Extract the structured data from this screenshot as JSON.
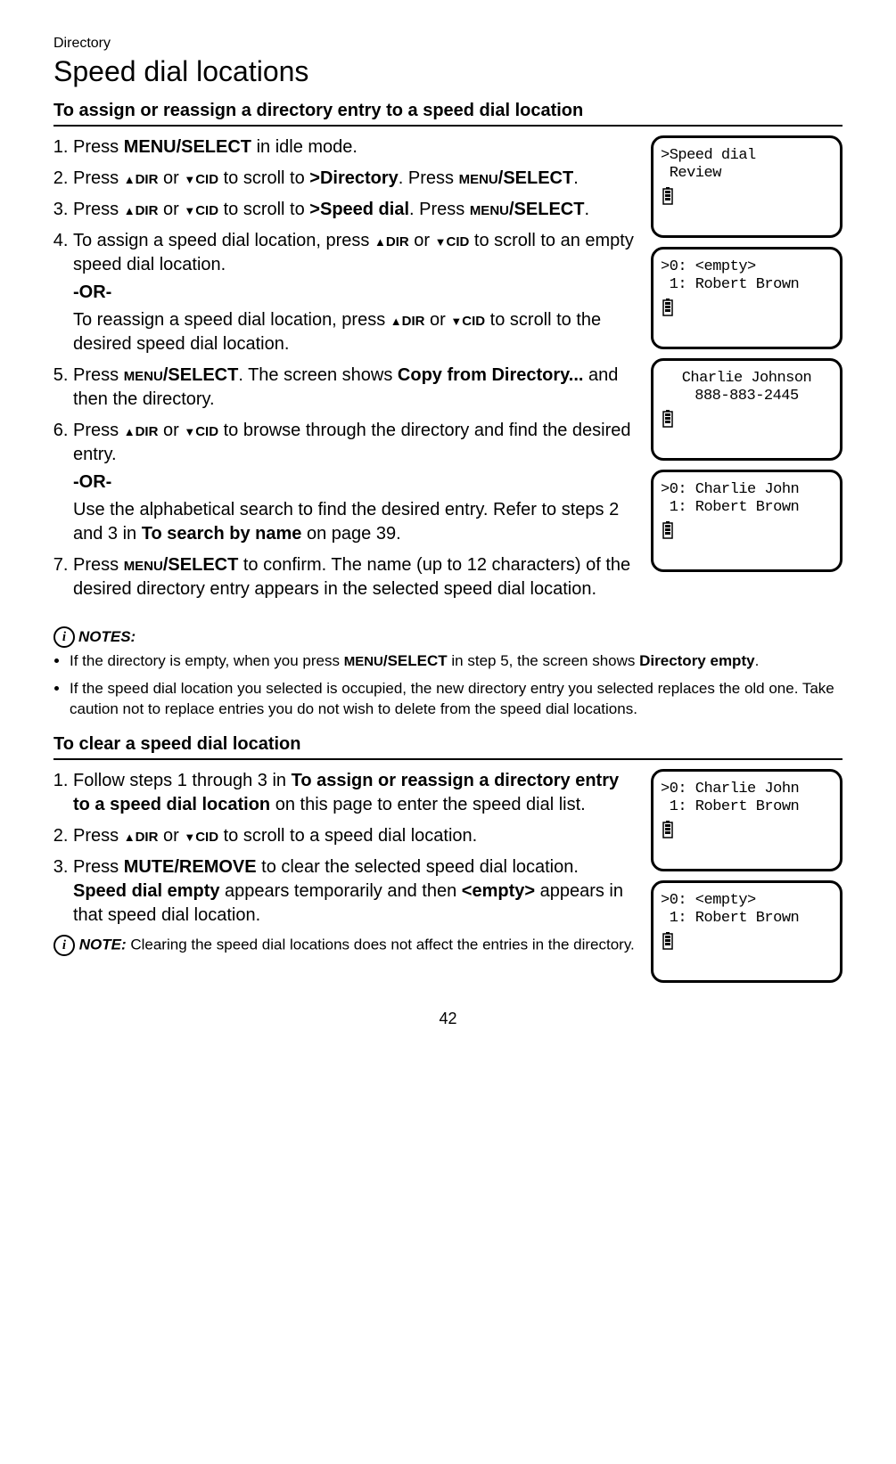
{
  "header": {
    "breadcrumb": "Directory",
    "title": "Speed dial locations"
  },
  "section1": {
    "heading": "To assign or reassign a directory entry to a speed dial location",
    "step1": {
      "pre": "Press ",
      "b1": "MENU/SELECT",
      "post": " in idle mode."
    },
    "step2": {
      "pre": "Press ",
      "dir": "DIR",
      "mid1": " or ",
      "cid": "CID",
      "mid2": " to scroll to ",
      "b1": ">Directory",
      "mid3": ". Press ",
      "sc": "MENU",
      "b2": "/SELECT",
      "post": "."
    },
    "step3": {
      "pre": "Press ",
      "dir": "DIR",
      "mid1": " or ",
      "cid": "CID",
      "mid2": " to scroll to ",
      "b1": ">Speed dial",
      "mid3": ". Press ",
      "sc": "MENU",
      "b2": "/SELECT",
      "post": "."
    },
    "step4": {
      "pre": "To assign a speed dial location, press ",
      "dir": "DIR",
      "mid1": " or ",
      "cid": "CID",
      "post1": " to scroll to an empty speed dial location.",
      "or": "-OR-",
      "pre2": "To reassign a speed dial location, press ",
      "dir2": "DIR",
      "mid2": " or ",
      "cid2": "CID",
      "post2": " to scroll to the desired speed dial location."
    },
    "step5": {
      "pre": "Press ",
      "sc": "MENU",
      "b1": "/SELECT",
      "mid": ". The screen shows ",
      "b2": "Copy from Directory...",
      "post": " and then the directory."
    },
    "step6": {
      "pre": "Press ",
      "dir": "DIR",
      "mid1": " or ",
      "cid": "CID",
      "post1": " to browse through the directory and find the desired entry.",
      "or": "-OR-",
      "sub": "Use the alphabetical search to find the desired entry. Refer to steps 2 and 3 in ",
      "b1": "To search by name",
      "post2": " on page 39."
    },
    "step7": {
      "pre": "Press ",
      "sc": "MENU",
      "b1": "/SELECT",
      "post": " to confirm. The name (up to 12 characters) of the desired directory entry appears in the selected speed dial location."
    },
    "notes_label": "NOTES:",
    "note1": {
      "pre": "If the directory is empty, when you press ",
      "sc": "MENU",
      "b1": "/SELECT",
      "mid": " in step 5, the screen shows ",
      "b2": "Directory empty",
      "post": "."
    },
    "note2": "If the speed dial location you selected is occupied, the new directory entry you selected replaces the old one. Take caution not to replace entries you do not wish to delete from the speed dial locations."
  },
  "section2": {
    "heading": "To clear a speed dial location",
    "step1": {
      "pre": "Follow steps 1 through 3 in ",
      "b1": "To assign or reassign a directory entry to a speed dial location",
      "post": " on this page to enter the speed dial list."
    },
    "step2": {
      "pre": "Press ",
      "dir": "DIR",
      "mid1": " or ",
      "cid": "CID",
      "post": " to scroll to a speed dial location."
    },
    "step3": {
      "pre": "Press ",
      "b1": "MUTE/REMOVE",
      "mid1": " to clear the selected speed dial location. ",
      "b2": "Speed dial empty",
      "mid2": " appears temporarily and then ",
      "b3": "<empty>",
      "post": " appears in that speed dial location."
    },
    "note_label": "NOTE:",
    "note": " Clearing the speed dial locations does not affect the entries in the directory."
  },
  "screens": {
    "s1": {
      "l1": ">Speed dial",
      "l2": " Review"
    },
    "s2": {
      "l1": ">0: <empty>",
      "l2": " 1: Robert Brown"
    },
    "s3": {
      "l1": "Charlie Johnson",
      "l2": "888-883-2445"
    },
    "s4": {
      "l1": ">0: Charlie John",
      "l2": " 1: Robert Brown"
    },
    "s5": {
      "l1": ">0: Charlie John",
      "l2": " 1: Robert Brown"
    },
    "s6": {
      "l1": ">0: <empty>",
      "l2": " 1: Robert Brown"
    }
  },
  "page_number": "42"
}
